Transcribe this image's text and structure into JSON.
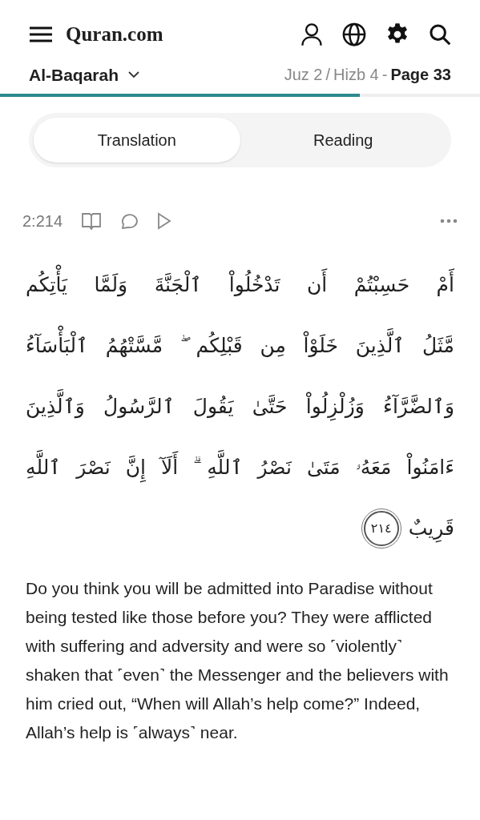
{
  "header": {
    "logo": "Quran.com"
  },
  "nav": {
    "surah": "Al-Baqarah",
    "juz": "Juz 2",
    "slash": "/",
    "hizb": "Hizb 4",
    "dash": "-",
    "page": "Page 33",
    "progress": {
      "level": 0.75
    }
  },
  "tabs": [
    {
      "label": "Translation",
      "selected": true
    },
    {
      "label": "Reading",
      "selected": false
    }
  ],
  "verse": {
    "key": "2:214",
    "arabic_lines": [
      "أَمْ حَسِبْتُمْ أَن تَدْخُلُواْ ٱلْجَنَّةَ وَلَمَّا يَأْتِكُم",
      "مَّثَلُ ٱلَّذِينَ خَلَوْاْ مِن قَبْلِكُم ۖ مَّسَّتْهُمُ ٱلْبَأْسَآءُ",
      "وَٱلضَّرَّآءُ وَزُلْزِلُواْ حَتَّىٰ يَقُولَ ٱلرَّسُولُ وَٱلَّذِينَ",
      "ءَامَنُواْ مَعَهُۥ مَتَىٰ نَصْرُ ٱللَّهِ ۗ أَلَآ إِنَّ نَصْرَ ٱللَّهِ",
      "قَرِيبٌ"
    ],
    "verse_number": "٢١٤",
    "translation": "Do you think you will be admitted into Paradise without being tested like those before you? They were afflicted with suffering and adversity and were so ˹violently˺ shaken that ˹even˺ the Messenger and the believers with him cried out, “When will Allah’s help come?” Indeed, Allah’s help is ˹always˺ near."
  }
}
